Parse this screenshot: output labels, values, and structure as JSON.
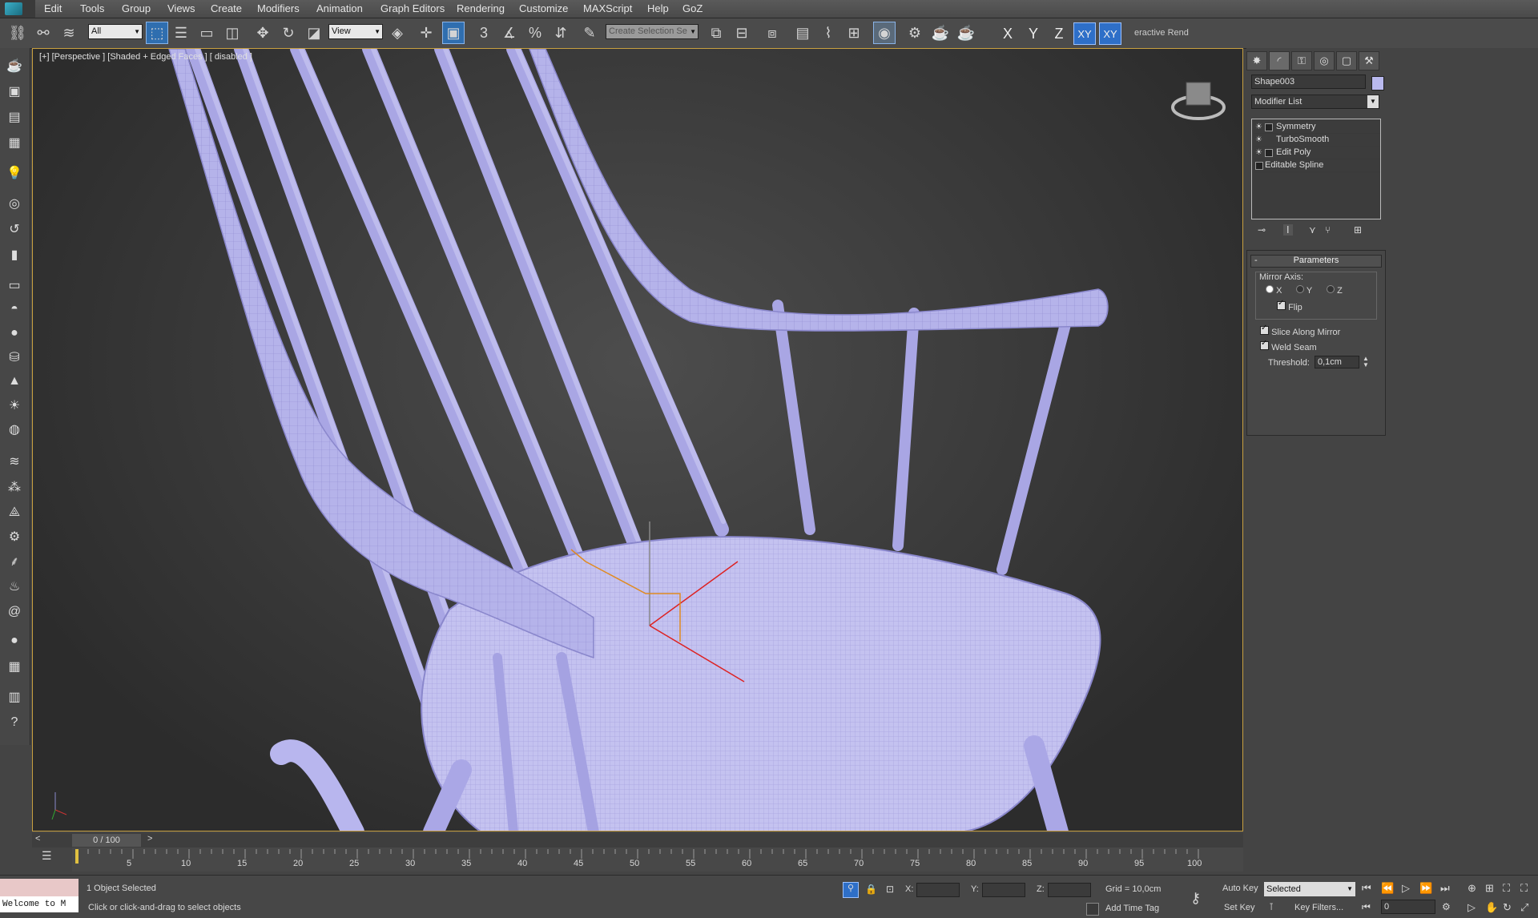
{
  "menu": {
    "items": [
      "Edit",
      "Tools",
      "Group",
      "Views",
      "Create",
      "Modifiers",
      "Animation",
      "Graph Editors",
      "Rendering",
      "Customize",
      "MAXScript",
      "Help",
      "GoZ"
    ]
  },
  "toolbar": {
    "selection_filter": "All",
    "reference_coord": "View",
    "named_selection_placeholder": "Create Selection Se",
    "snap_labels": {
      "snap": "3",
      "angle_snap": "",
      "percent_snap": "%"
    },
    "axis_buttons": [
      "X",
      "Y",
      "Z",
      "XY",
      "XY"
    ],
    "interactive_render_label": "eractive Rend"
  },
  "viewport": {
    "label": "[+] [Perspective ] [Shaded + Edged Faces ]  [ disabled ]"
  },
  "command_panel": {
    "object_name": "Shape003",
    "object_color": "#b9b9ee",
    "modifier_list_label": "Modifier List",
    "stack": [
      {
        "label": "Symmetry",
        "has_light": true
      },
      {
        "label": "TurboSmooth",
        "has_light": true
      },
      {
        "label": "Edit Poly",
        "has_light": true
      },
      {
        "label": "Editable Spline",
        "has_light": false
      }
    ],
    "parameters": {
      "title": "Parameters",
      "mirror_axis_label": "Mirror Axis:",
      "axes": [
        {
          "label": "X",
          "selected": true
        },
        {
          "label": "Y",
          "selected": false
        },
        {
          "label": "Z",
          "selected": false
        }
      ],
      "flip_label": "Flip",
      "flip": true,
      "slice_label": "Slice Along Mirror",
      "slice": true,
      "weld_label": "Weld Seam",
      "weld": true,
      "threshold_label": "Threshold:",
      "threshold_value": "0,1cm"
    }
  },
  "timeline": {
    "frame_display": "0 / 100",
    "ticks": [
      "5",
      "10",
      "15",
      "20",
      "25",
      "30",
      "35",
      "40",
      "45",
      "50",
      "55",
      "60",
      "65",
      "70",
      "75",
      "80",
      "85",
      "90",
      "95",
      "100"
    ]
  },
  "status": {
    "maxscript_listener": "Welcome to M",
    "objects_selected": "1 Object Selected",
    "prompt": "Click or click-and-drag to select objects",
    "x_label": "X:",
    "y_label": "Y:",
    "z_label": "Z:",
    "grid": "Grid = 10,0cm",
    "add_time_tag": "Add Time Tag",
    "auto_key": "Auto Key",
    "set_key": "Set Key",
    "selected_dropdown": "Selected",
    "key_filters": "Key Filters...",
    "current_frame": "0"
  }
}
